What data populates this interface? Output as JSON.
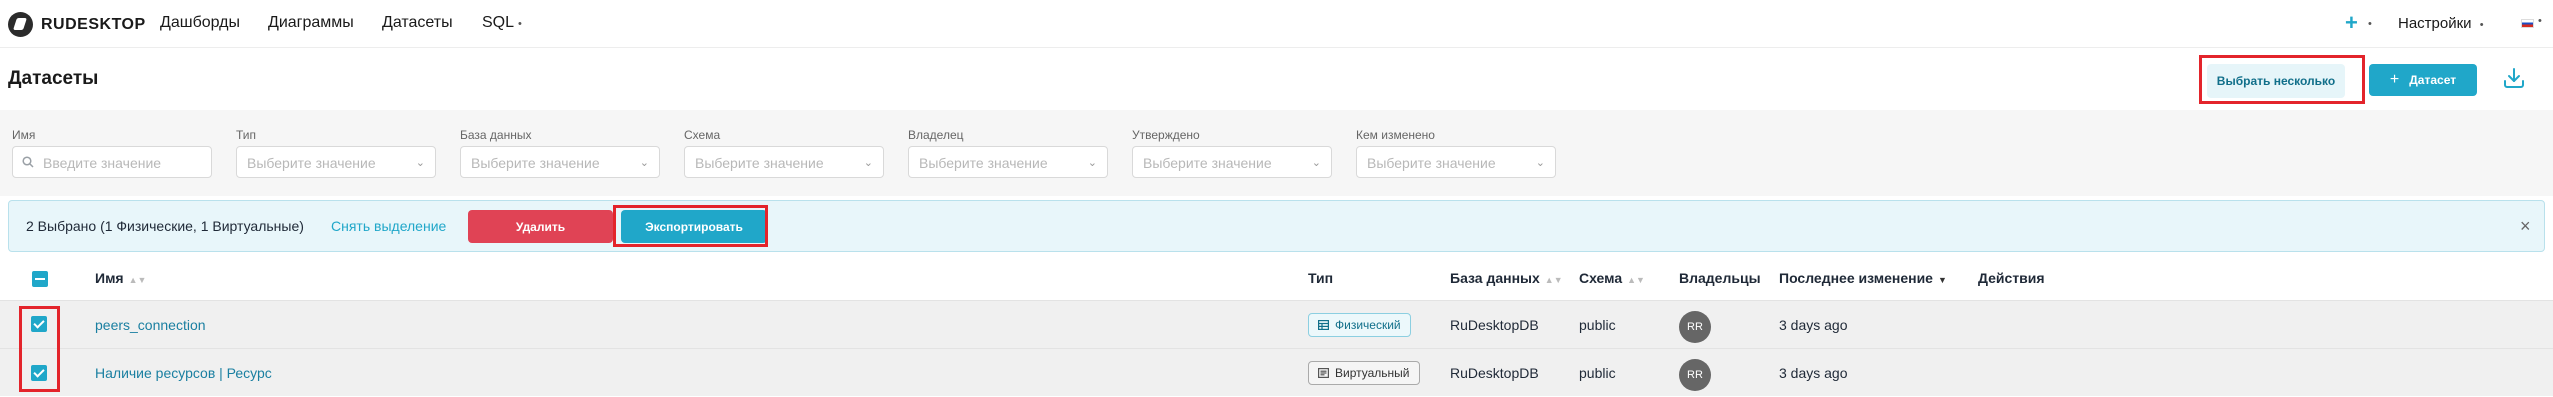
{
  "nav": {
    "logo_text": "RUDESKTOP",
    "items": [
      "Дашборды",
      "Диаграммы",
      "Датасеты",
      "SQL"
    ],
    "settings_label": "Настройки",
    "plus_label": "+"
  },
  "header": {
    "title": "Датасеты",
    "select_multiple_label": "Выбрать несколько",
    "add_dataset_label": "Датасет"
  },
  "filters": [
    {
      "label": "Имя",
      "placeholder": "Введите значение"
    },
    {
      "label": "Тип",
      "placeholder": "Выберите значение"
    },
    {
      "label": "База данных",
      "placeholder": "Выберите значение"
    },
    {
      "label": "Схема",
      "placeholder": "Выберите значение"
    },
    {
      "label": "Владелец",
      "placeholder": "Выберите значение"
    },
    {
      "label": "Утверждено",
      "placeholder": "Выберите значение"
    },
    {
      "label": "Кем изменено",
      "placeholder": "Выберите значение"
    }
  ],
  "bulk": {
    "count_text": "2 Выбрано (1 Физические, 1 Виртуальные)",
    "deselect_label": "Снять выделение",
    "delete_label": "Удалить",
    "export_label": "Экспортировать",
    "close_glyph": "×"
  },
  "table": {
    "headers": {
      "name": "Имя",
      "type": "Тип",
      "database": "База данных",
      "schema": "Схема",
      "owners": "Владельцы",
      "modified": "Последнее изменение",
      "actions": "Действия"
    },
    "rows": [
      {
        "name": "peers_connection",
        "type": "Физический",
        "database": "RuDesktopDB",
        "schema": "public",
        "owner_initials": "RR",
        "modified": "3 days ago",
        "selected": true
      },
      {
        "name": "Наличие ресурсов | Ресурс",
        "type": "Виртуальный",
        "database": "RuDesktopDB",
        "schema": "public",
        "owner_initials": "RR",
        "modified": "3 days ago",
        "selected": true
      }
    ]
  },
  "colors": {
    "accent": "#20a7c9",
    "danger": "#e04355",
    "highlight": "#e3242b"
  },
  "icons": [
    "logo-icon",
    "chevron-down-icon",
    "flag-ru-icon",
    "download-icon",
    "search-icon",
    "close-icon",
    "sort-icon",
    "table-icon",
    "sql-icon",
    "checkbox-icon"
  ]
}
